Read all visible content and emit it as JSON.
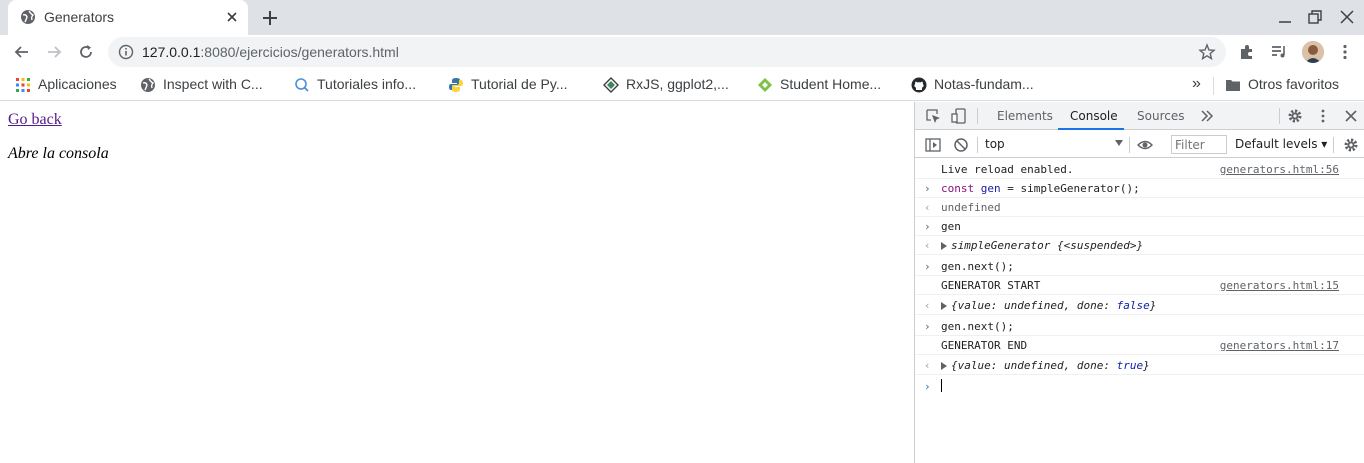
{
  "tab": {
    "title": "Generators"
  },
  "address": {
    "host": "127.0.0.1",
    "rest": ":8080/ejercicios/generators.html"
  },
  "bookmarks": [
    {
      "label": "Aplicaciones",
      "icon": "apps-grid-icon"
    },
    {
      "label": "Inspect with C...",
      "icon": "globe-icon"
    },
    {
      "label": "Tutoriales info...",
      "icon": "search-bulb-icon"
    },
    {
      "label": "Tutorial de Py...",
      "icon": "python-icon"
    },
    {
      "label": "RxJS, ggplot2,...",
      "icon": "diamond-icon"
    },
    {
      "label": "Student Home...",
      "icon": "student-icon"
    },
    {
      "label": "Notas-fundam...",
      "icon": "github-icon"
    }
  ],
  "bookmarks_more": "»",
  "other_bookmarks": "Otros favoritos",
  "page": {
    "link": "Go back",
    "text": "Abre la consola"
  },
  "devtools": {
    "tabs": [
      "Elements",
      "Console",
      "Sources"
    ],
    "active_tab": "Console",
    "context": "top",
    "filter_placeholder": "Filter",
    "levels": "Default levels ▾"
  },
  "console": {
    "live_reload": "Live reload enabled.",
    "src_56": "generators.html:56",
    "cmd1_kw": "const",
    "cmd1_var": "gen",
    "cmd1_rest": " = simpleGenerator();",
    "out_undefined": "undefined",
    "cmd2": "gen",
    "gen_obj": "simpleGenerator",
    "gen_state": "{<suspended>}",
    "cmd3": "gen.next();",
    "log_start": "GENERATOR START",
    "src_15": "generators.html:15",
    "res1_a": "{value: ",
    "res1_b": "undefined",
    "res1_c": ", done: ",
    "res1_d": "false",
    "res1_e": "}",
    "cmd4": "gen.next();",
    "log_end": "GENERATOR END",
    "src_17": "generators.html:17",
    "res2_a": "{value: ",
    "res2_b": "undefined",
    "res2_c": ", done: ",
    "res2_d": "true",
    "res2_e": "}"
  }
}
